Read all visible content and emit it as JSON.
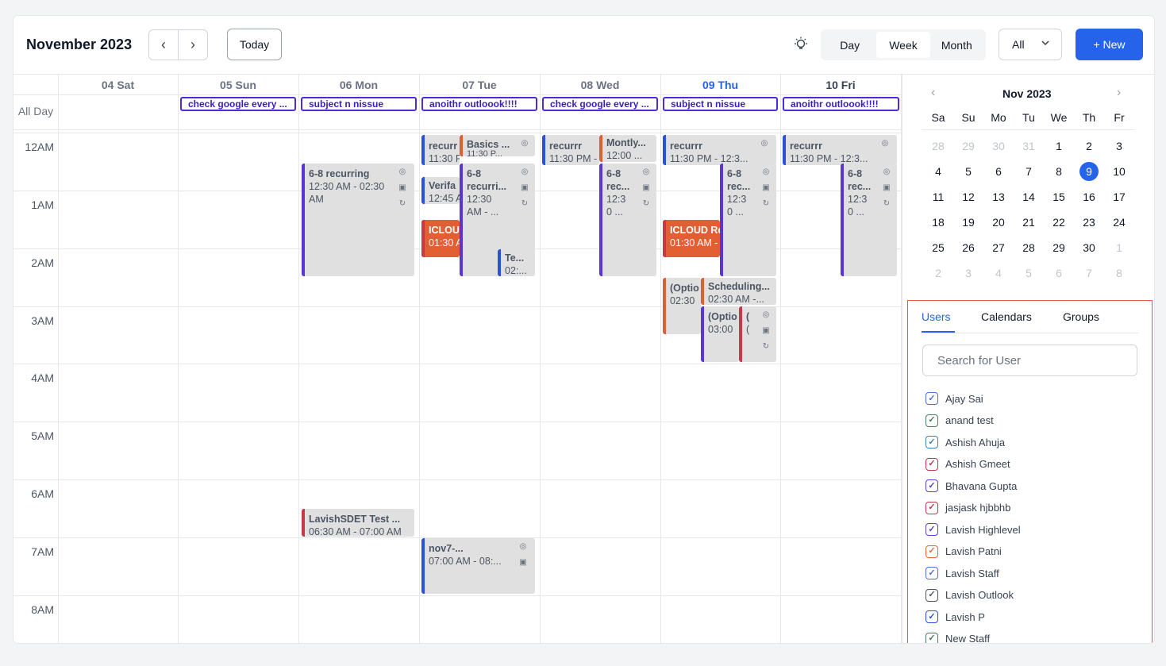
{
  "header": {
    "title": "November 2023",
    "prev_icon": "‹",
    "next_icon": "›",
    "today_label": "Today",
    "views": [
      "Day",
      "Week",
      "Month"
    ],
    "active_view": "Week",
    "filter_value": "All",
    "new_label": "+ New",
    "accent": "#2563eb"
  },
  "week": {
    "days": [
      {
        "label": "04 Sat"
      },
      {
        "label": "05 Sun"
      },
      {
        "label": "06 Mon"
      },
      {
        "label": "07 Tue"
      },
      {
        "label": "08 Wed"
      },
      {
        "label": "09 Thu"
      },
      {
        "label": "10 Fri"
      }
    ],
    "all_day_label": "All Day",
    "hours": [
      "12AM",
      "1AM",
      "2AM",
      "3AM",
      "4AM",
      "5AM",
      "6AM",
      "7AM",
      "8AM"
    ],
    "all_day_events": [
      "check google every ...",
      "subject n nissue",
      "anoithr outloook!!!!",
      "check google every ...",
      "subject n nissue",
      "anoithr outloook!!!!"
    ]
  },
  "events": {
    "mon_recurring_title": "6-8 recurring",
    "mon_recurring_time1": "12:30 AM - 02:30",
    "mon_recurring_time2": "AM",
    "mon_lavish_title": "LavishSDET Test ...",
    "mon_lavish_time": "06:30 AM - 07:00 AM",
    "tue_recurr_title": "recurr",
    "tue_recurr_time": "11:30 P",
    "tue_basics_title": "Basics ...",
    "tue_basics_time": "11:30 P...",
    "tue_68_title": "6-8",
    "tue_68_l2": "recurri...",
    "tue_68_l3": "12:30",
    "tue_68_l4": "AM - ...",
    "tue_verify_title": "Verifa",
    "tue_verify_time": "12:45 A",
    "tue_icloud_title": "ICLOU",
    "tue_icloud_time": "01:30 A",
    "tue_te_title": "Te...",
    "tue_te_time": "02:...",
    "tue_nov7_title": "nov7-...",
    "tue_nov7_time": "07:00 AM - 08:...",
    "wed_recurrr_title": "recurrr",
    "wed_recurrr_time": "11:30 PM -",
    "wed_montly_title": "Montly...",
    "wed_montly_time": "12:00 ...",
    "wed_68_title": "6-8",
    "wed_68_l2": "rec...",
    "wed_68_l3": "12:3",
    "wed_68_l4": "0 ...",
    "thu_recurrr_title": "recurrr",
    "thu_recurrr_time": "11:30 PM - 12:3...",
    "thu_68_title": "6-8",
    "thu_68_l2": "rec...",
    "thu_68_l3": "12:3",
    "thu_68_l4": "0 ...",
    "thu_icloud_title": "ICLOUD Re",
    "thu_icloud_time": "01:30 AM -",
    "thu_optio_title": "(Optio",
    "thu_optio_time": "02:30",
    "thu_sched_title": "Scheduling...",
    "thu_sched_time": "02:30 AM -...",
    "thu_optio2_title": "(Optio",
    "thu_optio2_time": "03:00",
    "thu_paren_title": "(",
    "thu_paren_time": "(",
    "fri_recurrr_title": "recurrr",
    "fri_recurrr_time": "11:30 PM - 12:3...",
    "fri_68_title": "6-8",
    "fri_68_l2": "rec...",
    "fri_68_l3": "12:3",
    "fri_68_l4": "0 ..."
  },
  "mini_calendar": {
    "title": "Nov 2023",
    "weekdays": [
      "Sa",
      "Su",
      "Mo",
      "Tu",
      "We",
      "Th",
      "Fr"
    ],
    "rows": [
      [
        "28",
        "29",
        "30",
        "31",
        "1",
        "2",
        "3"
      ],
      [
        "4",
        "5",
        "6",
        "7",
        "8",
        "9",
        "10"
      ],
      [
        "11",
        "12",
        "13",
        "14",
        "15",
        "16",
        "17"
      ],
      [
        "18",
        "19",
        "20",
        "21",
        "22",
        "23",
        "24"
      ],
      [
        "25",
        "26",
        "27",
        "28",
        "29",
        "30",
        "1"
      ],
      [
        "2",
        "3",
        "4",
        "5",
        "6",
        "7",
        "8"
      ]
    ],
    "selected_day": "9"
  },
  "panel": {
    "tabs": [
      "Users",
      "Calendars",
      "Groups"
    ],
    "active_tab": "Users",
    "search_placeholder": "Search for User",
    "users": [
      {
        "name": "Ajay Sai",
        "color": "#4f6fd8"
      },
      {
        "name": "anand test",
        "color": "#4b7a5e"
      },
      {
        "name": "Ashish Ahuja",
        "color": "#3d7fae"
      },
      {
        "name": "Ashish Gmeet",
        "color": "#c5364e"
      },
      {
        "name": "Bhavana Gupta",
        "color": "#5b3fd0"
      },
      {
        "name": "jasjask hjbbhb",
        "color": "#c5364e"
      },
      {
        "name": "Lavish Highlevel",
        "color": "#5b3fd0"
      },
      {
        "name": "Lavish Patni",
        "color": "#e2673a"
      },
      {
        "name": "Lavish Staff",
        "color": "#4f6fd8"
      },
      {
        "name": "Lavish Outlook",
        "color": "#4b5563"
      },
      {
        "name": "Lavish P",
        "color": "#2c50d8"
      },
      {
        "name": "New Staff",
        "color": "#4b7a5e"
      }
    ]
  }
}
